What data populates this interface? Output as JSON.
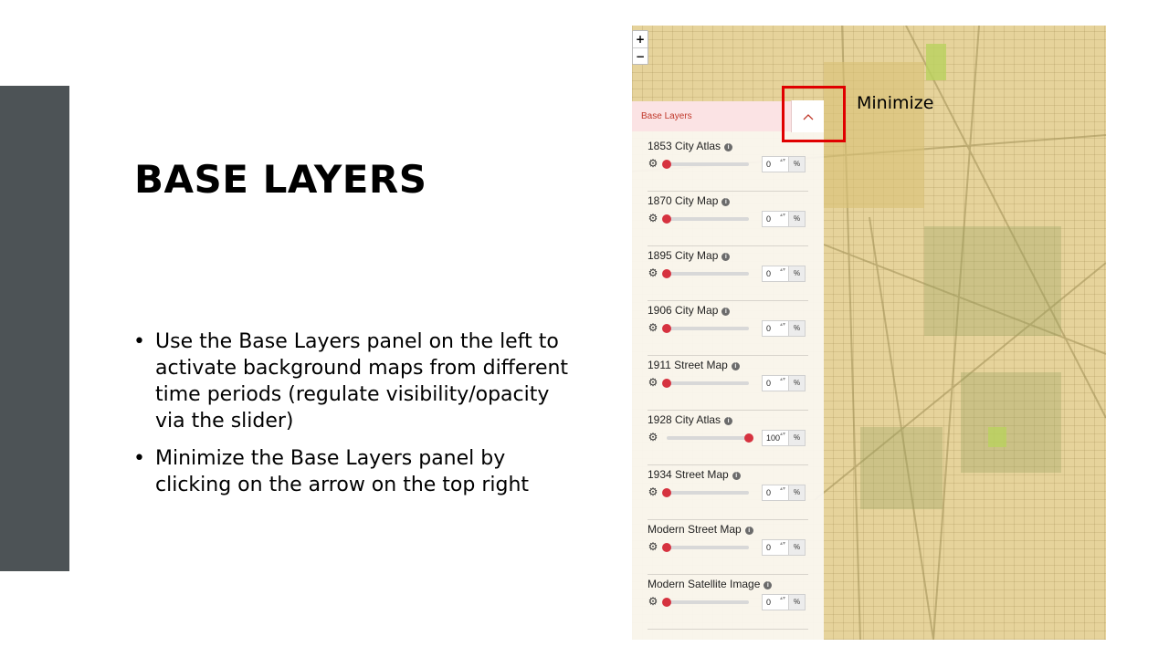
{
  "slide": {
    "title": "BASE LAYERS",
    "bullet_symbol": "•",
    "bullets": [
      "Use the Base Layers panel on the left to activate background maps from different time periods (regulate visibility/opacity via the slider)",
      "Minimize the Base Layers panel by clicking on the arrow on the top right"
    ],
    "callout": "Minimize"
  },
  "map": {
    "zoom_in": "+",
    "zoom_out": "−"
  },
  "panel": {
    "title": "Base Layers",
    "collapse_icon": "chevron-up-icon",
    "info_glyph": "i",
    "gear_glyph": "⚙",
    "percent_label": "%",
    "spinner_glyph": "▴▾",
    "accent_color": "#d6323f",
    "header_bg": "#fbe3e4",
    "layers": [
      {
        "name": "1853 City Atlas",
        "value": "0",
        "opacity": 0
      },
      {
        "name": "1870 City Map",
        "value": "0",
        "opacity": 0
      },
      {
        "name": "1895 City Map",
        "value": "0",
        "opacity": 0
      },
      {
        "name": "1906 City Map",
        "value": "0",
        "opacity": 0
      },
      {
        "name": "1911 Street Map",
        "value": "0",
        "opacity": 0
      },
      {
        "name": "1928 City Atlas",
        "value": "100",
        "opacity": 1
      },
      {
        "name": "1934 Street Map",
        "value": "0",
        "opacity": 0
      },
      {
        "name": "Modern Street Map",
        "value": "0",
        "opacity": 0
      },
      {
        "name": "Modern Satellite Image",
        "value": "0",
        "opacity": 0
      }
    ]
  }
}
